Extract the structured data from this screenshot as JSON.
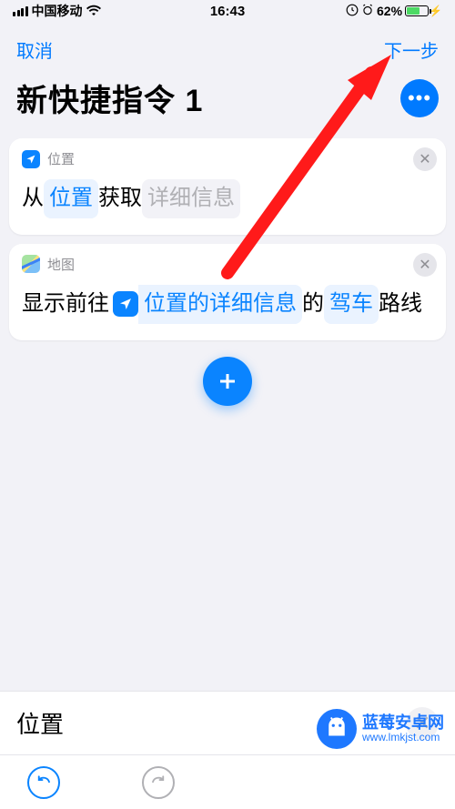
{
  "status": {
    "carrier": "中国移动",
    "time": "16:43",
    "battery_pct": "62%"
  },
  "nav": {
    "cancel": "取消",
    "next": "下一步"
  },
  "title": "新快捷指令 1",
  "cards": {
    "location": {
      "header": "位置",
      "t1": "从",
      "chip_location": "位置",
      "t2": "获取",
      "chip_detail": "详细信息"
    },
    "maps": {
      "header": "地图",
      "t1": "显示前往",
      "chip_detail": "位置的详细信息",
      "t2": "的",
      "chip_drive": "驾车",
      "t3": "路线"
    }
  },
  "search": {
    "label": "位置"
  },
  "watermark": {
    "line1": "蓝莓安卓网",
    "line2": "www.lmkjst.com"
  }
}
